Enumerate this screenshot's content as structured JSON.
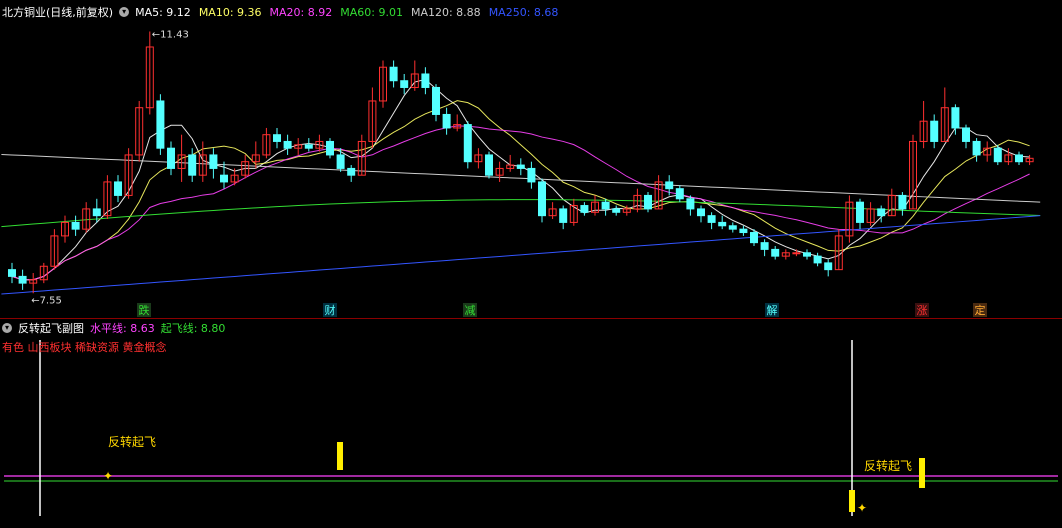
{
  "main": {
    "title": "北方铜业(日线,前复权)",
    "ma": [
      {
        "label": "MA5: 9.12",
        "color": "#ffffff"
      },
      {
        "label": "MA10: 9.36",
        "color": "#ffff66"
      },
      {
        "label": "MA20: 8.92",
        "color": "#ff44ff"
      },
      {
        "label": "MA60: 9.01",
        "color": "#33dd33"
      },
      {
        "label": "MA120: 8.88",
        "color": "#cccccc"
      },
      {
        "label": "MA250: 8.68",
        "color": "#3355ff"
      }
    ],
    "high_label": "11.43",
    "low_label": "7.55",
    "markers": [
      "跌",
      "财",
      "减",
      "解",
      "涨",
      "定"
    ]
  },
  "sub": {
    "title": "反转起飞副图",
    "level_label": "水平线: 8.63",
    "takeoff_label": "起飞线: 8.80",
    "concepts": "有色 山西板块 稀缺资源 黄金概念",
    "signal_text": "反转起飞"
  },
  "chart_data": {
    "type": "candlestick",
    "title": "北方铜业(日线,前复权)",
    "annotations": {
      "max": 11.43,
      "min": 7.55
    },
    "candles": [
      [
        7.9,
        7.8,
        8.0,
        7.7
      ],
      [
        7.8,
        7.7,
        7.9,
        7.6
      ],
      [
        7.7,
        7.75,
        7.85,
        7.55
      ],
      [
        7.75,
        7.95,
        8.0,
        7.7
      ],
      [
        7.95,
        8.4,
        8.5,
        7.9
      ],
      [
        8.4,
        8.6,
        8.7,
        8.3
      ],
      [
        8.6,
        8.5,
        8.7,
        8.4
      ],
      [
        8.5,
        8.8,
        8.9,
        8.45
      ],
      [
        8.8,
        8.7,
        8.95,
        8.6
      ],
      [
        8.7,
        9.2,
        9.3,
        8.65
      ],
      [
        9.2,
        9.0,
        9.3,
        8.9
      ],
      [
        9.0,
        9.6,
        9.7,
        8.95
      ],
      [
        9.6,
        10.3,
        10.4,
        9.5
      ],
      [
        10.3,
        11.2,
        11.43,
        10.2
      ],
      [
        10.4,
        9.7,
        10.5,
        9.6
      ],
      [
        9.7,
        9.4,
        9.8,
        9.3
      ],
      [
        9.4,
        9.6,
        9.9,
        9.2
      ],
      [
        9.6,
        9.3,
        9.7,
        9.2
      ],
      [
        9.3,
        9.6,
        9.8,
        9.2
      ],
      [
        9.6,
        9.4,
        9.7,
        9.25
      ],
      [
        9.3,
        9.2,
        9.5,
        9.1
      ],
      [
        9.2,
        9.3,
        9.4,
        9.15
      ],
      [
        9.3,
        9.5,
        9.6,
        9.25
      ],
      [
        9.5,
        9.6,
        9.8,
        9.4
      ],
      [
        9.6,
        9.9,
        10.0,
        9.55
      ],
      [
        9.9,
        9.8,
        10.0,
        9.7
      ],
      [
        9.8,
        9.7,
        9.9,
        9.6
      ],
      [
        9.7,
        9.75,
        9.85,
        9.6
      ],
      [
        9.75,
        9.7,
        9.85,
        9.65
      ],
      [
        9.7,
        9.8,
        9.9,
        9.65
      ],
      [
        9.8,
        9.6,
        9.85,
        9.55
      ],
      [
        9.6,
        9.4,
        9.7,
        9.35
      ],
      [
        9.4,
        9.3,
        9.45,
        9.2
      ],
      [
        9.3,
        9.8,
        9.9,
        9.3
      ],
      [
        9.8,
        10.4,
        10.6,
        9.7
      ],
      [
        10.4,
        10.9,
        11.0,
        10.3
      ],
      [
        10.9,
        10.7,
        11.0,
        10.6
      ],
      [
        10.7,
        10.6,
        10.8,
        10.5
      ],
      [
        10.6,
        10.8,
        11.0,
        10.55
      ],
      [
        10.8,
        10.6,
        10.9,
        10.5
      ],
      [
        10.6,
        10.2,
        10.65,
        10.1
      ],
      [
        10.2,
        10.0,
        10.3,
        9.9
      ],
      [
        10.0,
        10.05,
        10.2,
        9.95
      ],
      [
        10.05,
        9.5,
        10.1,
        9.4
      ],
      [
        9.5,
        9.6,
        9.7,
        9.4
      ],
      [
        9.6,
        9.3,
        9.65,
        9.25
      ],
      [
        9.3,
        9.4,
        9.5,
        9.2
      ],
      [
        9.4,
        9.45,
        9.6,
        9.35
      ],
      [
        9.45,
        9.4,
        9.55,
        9.3
      ],
      [
        9.4,
        9.2,
        9.5,
        9.1
      ],
      [
        9.2,
        8.7,
        9.25,
        8.6
      ],
      [
        8.7,
        8.8,
        8.9,
        8.65
      ],
      [
        8.8,
        8.6,
        8.85,
        8.5
      ],
      [
        8.6,
        8.85,
        8.95,
        8.55
      ],
      [
        8.85,
        8.75,
        8.9,
        8.7
      ],
      [
        8.75,
        8.9,
        9.0,
        8.7
      ],
      [
        8.9,
        8.8,
        8.95,
        8.7
      ],
      [
        8.8,
        8.75,
        8.85,
        8.7
      ],
      [
        8.75,
        8.8,
        8.85,
        8.7
      ],
      [
        8.8,
        9.0,
        9.1,
        8.75
      ],
      [
        9.0,
        8.8,
        9.05,
        8.75
      ],
      [
        8.8,
        9.2,
        9.3,
        8.8
      ],
      [
        9.2,
        9.1,
        9.3,
        9.0
      ],
      [
        9.1,
        8.95,
        9.15,
        8.9
      ],
      [
        8.95,
        8.8,
        9.0,
        8.7
      ],
      [
        8.8,
        8.7,
        8.85,
        8.6
      ],
      [
        8.7,
        8.6,
        8.75,
        8.5
      ],
      [
        8.6,
        8.55,
        8.7,
        8.5
      ],
      [
        8.55,
        8.5,
        8.6,
        8.45
      ],
      [
        8.5,
        8.45,
        8.55,
        8.4
      ],
      [
        8.45,
        8.3,
        8.5,
        8.25
      ],
      [
        8.3,
        8.2,
        8.35,
        8.1
      ],
      [
        8.2,
        8.1,
        8.25,
        8.05
      ],
      [
        8.1,
        8.15,
        8.2,
        8.05
      ],
      [
        8.15,
        8.15,
        8.2,
        8.1
      ],
      [
        8.15,
        8.1,
        8.2,
        8.05
      ],
      [
        8.1,
        8.0,
        8.15,
        7.95
      ],
      [
        8.0,
        7.9,
        8.05,
        7.8
      ],
      [
        7.9,
        8.4,
        8.5,
        7.9
      ],
      [
        8.4,
        8.9,
        9.0,
        8.3
      ],
      [
        8.9,
        8.6,
        8.95,
        8.5
      ],
      [
        8.6,
        8.8,
        8.9,
        8.55
      ],
      [
        8.8,
        8.7,
        8.85,
        8.6
      ],
      [
        8.7,
        9.0,
        9.1,
        8.7
      ],
      [
        9.0,
        8.8,
        9.05,
        8.7
      ],
      [
        8.8,
        9.8,
        9.9,
        8.8
      ],
      [
        9.8,
        10.1,
        10.4,
        9.7
      ],
      [
        10.1,
        9.8,
        10.2,
        9.7
      ],
      [
        9.8,
        10.3,
        10.6,
        9.8
      ],
      [
        10.3,
        10.0,
        10.35,
        9.9
      ],
      [
        10.0,
        9.8,
        10.05,
        9.7
      ],
      [
        9.8,
        9.6,
        9.85,
        9.5
      ],
      [
        9.6,
        9.7,
        9.8,
        9.5
      ],
      [
        9.7,
        9.5,
        9.75,
        9.45
      ],
      [
        9.5,
        9.6,
        9.7,
        9.45
      ],
      [
        9.6,
        9.5,
        9.65,
        9.45
      ],
      [
        9.5,
        9.55,
        9.6,
        9.45
      ]
    ],
    "ma_lines": {
      "MA5": 9.12,
      "MA10": 9.36,
      "MA20": 8.92,
      "MA60": 9.01,
      "MA120": 8.88,
      "MA250": 8.68
    },
    "sub_levels": {
      "水平线": 8.63,
      "起飞线": 8.8
    },
    "signals": [
      {
        "index": 3,
        "label": "反转起飞"
      },
      {
        "index": 85,
        "label": "反转起飞"
      }
    ]
  }
}
